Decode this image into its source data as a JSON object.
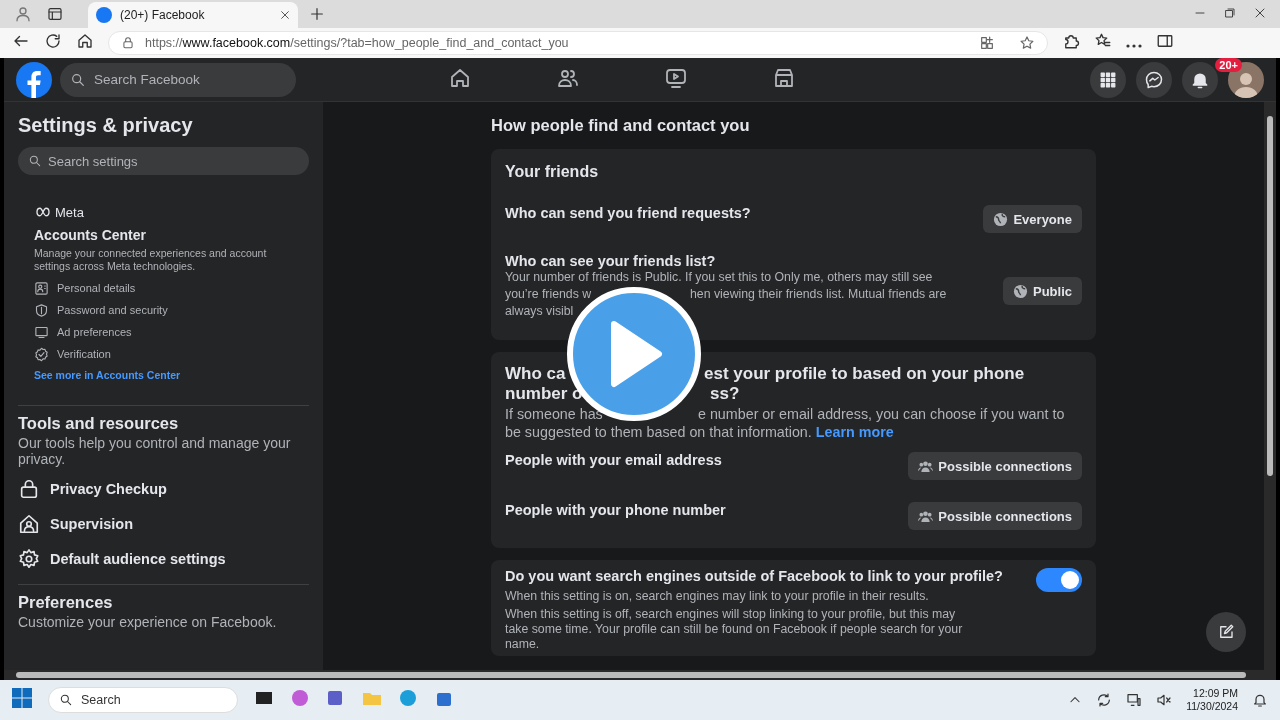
{
  "browser": {
    "tabs": [
      {
        "title": "(20+) Facebook",
        "selected": true
      }
    ],
    "url": {
      "scheme": "https://",
      "host": "www.facebook.com",
      "path": "/settings/?tab=how_people_find_and_contact_you"
    }
  },
  "topbar": {
    "search_placeholder": "Search Facebook",
    "notification_badge": "20+"
  },
  "sidebar": {
    "title": "Settings & privacy",
    "search_placeholder": "Search settings",
    "accounts_center": {
      "brand": "Meta",
      "title": "Accounts Center",
      "description": "Manage your connected experiences and account settings across Meta technologies.",
      "items": [
        {
          "kind": "person",
          "label": "Personal details"
        },
        {
          "kind": "shield",
          "label": "Password and security"
        },
        {
          "kind": "screen",
          "label": "Ad preferences"
        },
        {
          "kind": "check",
          "label": "Verification"
        }
      ],
      "link": "See more in Accounts Center"
    },
    "tools": {
      "title": "Tools and resources",
      "description": "Our tools help you control and manage your privacy.",
      "items": [
        {
          "kind": "lock",
          "label": "Privacy Checkup"
        },
        {
          "kind": "supervision",
          "label": "Supervision"
        },
        {
          "kind": "gear",
          "label": "Default audience settings"
        }
      ]
    },
    "preferences": {
      "title": "Preferences",
      "description": "Customize your experience on Facebook."
    }
  },
  "main": {
    "title": "How people find and contact you",
    "friends_card": {
      "title": "Your friends",
      "rows": [
        {
          "question": "Who can send you friend requests?",
          "description_lines": [],
          "button": "Everyone"
        },
        {
          "question": "Who can see your friends list?",
          "description_lines": [
            [
              "Your number of friends is Public. If you set this to Only me, others may still see"
            ],
            [
              "you’re friends w",
              "hen viewing their friends list. Mutual friends are"
            ],
            [
              "always visibl"
            ]
          ],
          "button": "Public"
        }
      ]
    },
    "lookup_card": {
      "title_lines": [
        [
          "Who ca",
          "est your profile to based on your phone"
        ],
        [
          "number o",
          "ss?"
        ]
      ],
      "description_lines": [
        [
          "If someone has",
          "e number or email address, you can choose if you want to"
        ],
        [
          "be suggested to them based on that information."
        ]
      ],
      "link": "Learn more",
      "rows": [
        {
          "label": "People with your email address",
          "button": "Possible connections"
        },
        {
          "label": "People with your phone number",
          "button": "Possible connections"
        }
      ]
    },
    "search_engines_card": {
      "question": "Do you want search engines outside of Facebook to link to your profile?",
      "on": true,
      "descriptions": [
        [
          "When this setting is on, search engines may link to your profile in their results."
        ],
        [
          "When this setting is off, search engines will stop linking to your profile, but this may",
          "take some time. Your profile can still be found on Facebook if people search for your",
          "name."
        ]
      ]
    }
  },
  "taskbar": {
    "search_placeholder": "Search",
    "time": "12:09 PM",
    "date": "11/30/2024"
  }
}
